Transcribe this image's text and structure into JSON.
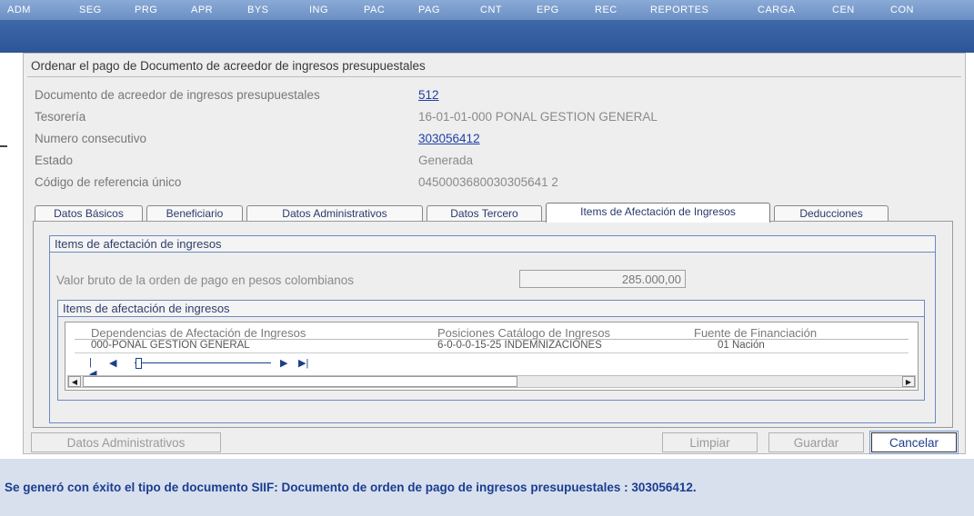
{
  "menu": [
    "ADM",
    "SEG",
    "PRG",
    "APR",
    "BYS",
    "ING",
    "PAC",
    "PAG",
    "CNT",
    "EPG",
    "REC",
    "REPORTES",
    "CARGA",
    "CEN",
    "CON"
  ],
  "panel": {
    "title": "Ordenar el pago de Documento de acreedor de ingresos presupuestales",
    "fields": {
      "doc_label": "Documento de acreedor de ingresos presupuestales",
      "doc_value": "512",
      "tesoreria_label": "Tesorería",
      "tesoreria_value": "16-01-01-000 PONAL GESTION GENERAL",
      "consecutivo_label": "Numero consecutivo",
      "consecutivo_value": "303056412",
      "estado_label": "Estado",
      "estado_value": "Generada",
      "codigo_label": "Código de referencia único",
      "codigo_value": "0450003680030305641 2"
    }
  },
  "tabs": [
    "Datos Básicos",
    "Beneficiario",
    "Datos Administrativos",
    "Datos Tercero",
    "Items de Afectación de Ingresos",
    "Deducciones"
  ],
  "active_tab": "Items de Afectación de Ingresos",
  "items_section": {
    "title": "Items de afectación de ingresos",
    "valor_label": "Valor bruto de la orden de pago en pesos colombianos",
    "valor_value": "285.000,00",
    "inner_title": "Items de afectación de ingresos",
    "columns": [
      "Dependencias de Afectación de Ingresos",
      "Posiciones Catálogo de Ingresos",
      "Fuente de Financiación"
    ],
    "rows": [
      [
        "000-PONAL GESTION GENERAL",
        "6-0-0-0-15-25 INDEMNIZACIONES",
        "01 Nación"
      ]
    ]
  },
  "pager": {
    "first": "|◀",
    "prev": "◀",
    "next": "▶",
    "last": "▶|"
  },
  "buttons": {
    "datos_adm": "Datos Administrativos",
    "limpiar": "Limpiar",
    "guardar": "Guardar",
    "cancelar": "Cancelar"
  },
  "message": "Se generó con éxito el tipo de documento SIIF: Documento de orden de pago de ingresos presupuestales : 303056412."
}
